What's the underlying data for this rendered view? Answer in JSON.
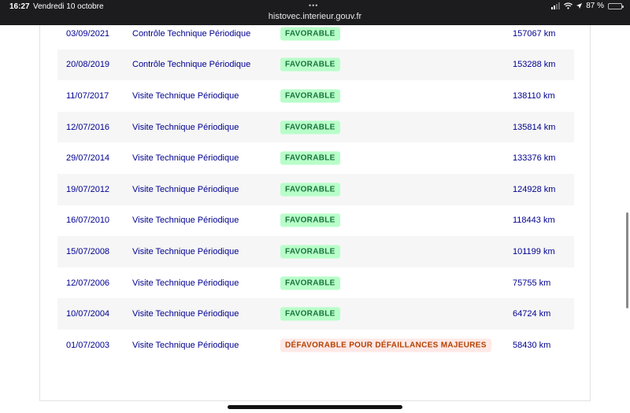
{
  "status_bar": {
    "time": "16:27",
    "date": "Vendredi 10 octobre",
    "url": "histovec.interieur.gouv.fr",
    "battery": "87 %"
  },
  "colors": {
    "primary_blue": "#000091",
    "favorable_bg": "#b8fec9",
    "favorable_text": "#18753c",
    "defavorable_bg": "#ffe9e6",
    "defavorable_text": "#b34000"
  },
  "history": [
    {
      "date": "03/09/2021",
      "type": "Contrôle Technique Périodique",
      "result": "FAVORABLE",
      "status": "ok",
      "km": "157067 km"
    },
    {
      "date": "20/08/2019",
      "type": "Contrôle Technique Périodique",
      "result": "FAVORABLE",
      "status": "ok",
      "km": "153288 km"
    },
    {
      "date": "11/07/2017",
      "type": "Visite Technique Périodique",
      "result": "FAVORABLE",
      "status": "ok",
      "km": "138110 km"
    },
    {
      "date": "12/07/2016",
      "type": "Visite Technique Périodique",
      "result": "FAVORABLE",
      "status": "ok",
      "km": "135814 km"
    },
    {
      "date": "29/07/2014",
      "type": "Visite Technique Périodique",
      "result": "FAVORABLE",
      "status": "ok",
      "km": "133376 km"
    },
    {
      "date": "19/07/2012",
      "type": "Visite Technique Périodique",
      "result": "FAVORABLE",
      "status": "ok",
      "km": "124928 km"
    },
    {
      "date": "16/07/2010",
      "type": "Visite Technique Périodique",
      "result": "FAVORABLE",
      "status": "ok",
      "km": "118443 km"
    },
    {
      "date": "15/07/2008",
      "type": "Visite Technique Périodique",
      "result": "FAVORABLE",
      "status": "ok",
      "km": "101199 km"
    },
    {
      "date": "12/07/2006",
      "type": "Visite Technique Périodique",
      "result": "FAVORABLE",
      "status": "ok",
      "km": "75755 km"
    },
    {
      "date": "10/07/2004",
      "type": "Visite Technique Périodique",
      "result": "FAVORABLE",
      "status": "ok",
      "km": "64724 km"
    },
    {
      "date": "01/07/2003",
      "type": "Visite Technique Périodique",
      "result": "DÉFAVORABLE POUR DÉFAILLANCES MAJEURES",
      "status": "ko",
      "km": "58430 km"
    }
  ]
}
